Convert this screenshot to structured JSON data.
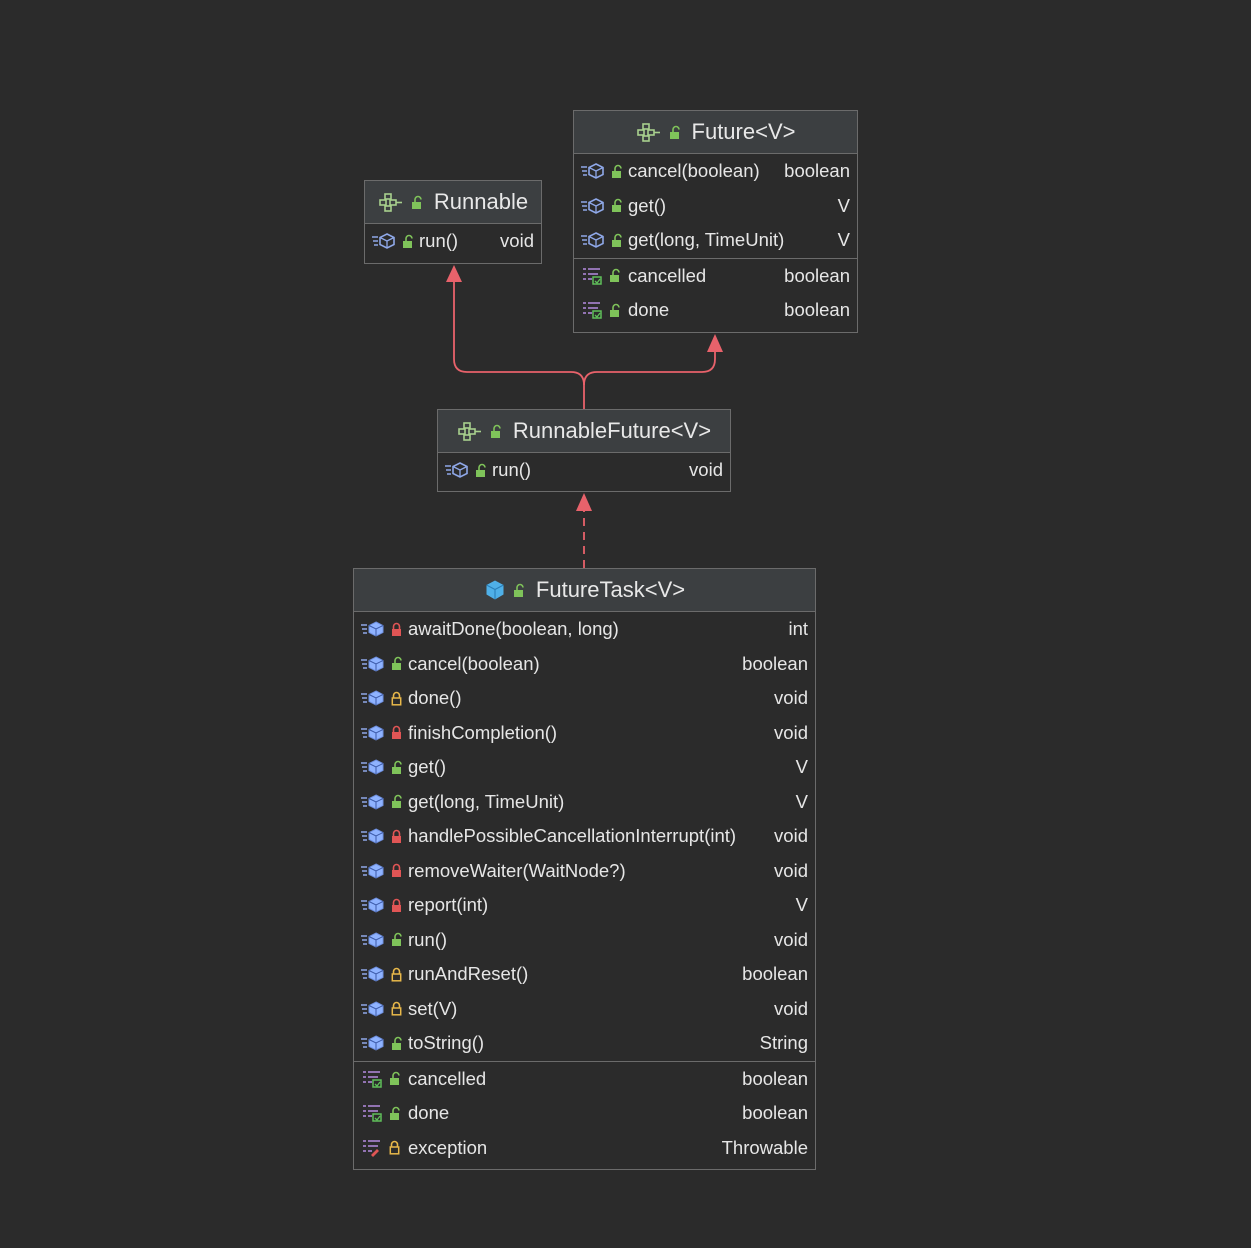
{
  "colors": {
    "background": "#2b2b2b",
    "header": "#3c3f41",
    "border": "#6b6b6b",
    "text": "#e6e6e6",
    "arrow": "#e8626b",
    "interface_icon": "#a8d08d",
    "class_icon": "#4fb0e8",
    "method_icon": "#8fa8e8",
    "field_icon": "#b58be0",
    "lock_public": "#7fc35a",
    "lock_private": "#e05555",
    "lock_protected": "#e8b84a"
  },
  "runnable": {
    "title": "Runnable",
    "kind_icon": "interface-icon",
    "methods": [
      {
        "name": "run()",
        "type": "void",
        "visibility": "public"
      }
    ]
  },
  "future": {
    "title": "Future<V>",
    "kind_icon": "interface-icon",
    "methods": [
      {
        "name": "cancel(boolean)",
        "type": "boolean",
        "visibility": "public"
      },
      {
        "name": "get()",
        "type": "V",
        "visibility": "public"
      },
      {
        "name": "get(long, TimeUnit)",
        "type": "V",
        "visibility": "public"
      }
    ],
    "fields": [
      {
        "name": "cancelled",
        "type": "boolean",
        "visibility": "public"
      },
      {
        "name": "done",
        "type": "boolean",
        "visibility": "public"
      }
    ]
  },
  "runnable_future": {
    "title": "RunnableFuture<V>",
    "kind_icon": "interface-icon",
    "methods": [
      {
        "name": "run()",
        "type": "void",
        "visibility": "public"
      }
    ]
  },
  "future_task": {
    "title": "FutureTask<V>",
    "kind_icon": "class-icon",
    "methods": [
      {
        "name": "awaitDone(boolean, long)",
        "type": "int",
        "visibility": "private"
      },
      {
        "name": "cancel(boolean)",
        "type": "boolean",
        "visibility": "public"
      },
      {
        "name": "done()",
        "type": "void",
        "visibility": "protected"
      },
      {
        "name": "finishCompletion()",
        "type": "void",
        "visibility": "private"
      },
      {
        "name": "get()",
        "type": "V",
        "visibility": "public"
      },
      {
        "name": "get(long, TimeUnit)",
        "type": "V",
        "visibility": "public"
      },
      {
        "name": "handlePossibleCancellationInterrupt(int)",
        "type": "void",
        "visibility": "private"
      },
      {
        "name": "removeWaiter(WaitNode?)",
        "type": "void",
        "visibility": "private"
      },
      {
        "name": "report(int)",
        "type": "V",
        "visibility": "private"
      },
      {
        "name": "run()",
        "type": "void",
        "visibility": "public"
      },
      {
        "name": "runAndReset()",
        "type": "boolean",
        "visibility": "protected"
      },
      {
        "name": "set(V)",
        "type": "void",
        "visibility": "protected"
      },
      {
        "name": "toString()",
        "type": "String",
        "visibility": "public"
      }
    ],
    "fields": [
      {
        "name": "cancelled",
        "type": "boolean",
        "visibility": "public",
        "kind": "property"
      },
      {
        "name": "done",
        "type": "boolean",
        "visibility": "public",
        "kind": "property"
      },
      {
        "name": "exception",
        "type": "Throwable",
        "visibility": "protected",
        "kind": "property-setter"
      }
    ]
  }
}
